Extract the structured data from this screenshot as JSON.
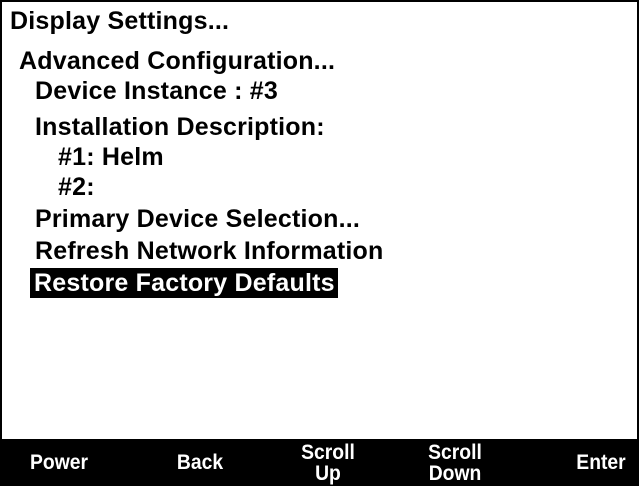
{
  "menu": {
    "items": [
      {
        "label": "Display Settings..."
      },
      {
        "label": "Advanced Configuration..."
      },
      {
        "label": "Device Instance : #3"
      },
      {
        "label": "Installation Description:"
      },
      {
        "label": "#1: Helm"
      },
      {
        "label": "#2:"
      },
      {
        "label": "Primary Device Selection..."
      },
      {
        "label": "Refresh Network Information"
      },
      {
        "label": "Restore Factory Defaults",
        "selected": true
      }
    ]
  },
  "softkeys": {
    "power": "Power",
    "back": "Back",
    "scroll_up": "Scroll\nUp",
    "scroll_down": "Scroll\nDown",
    "enter": "Enter"
  }
}
